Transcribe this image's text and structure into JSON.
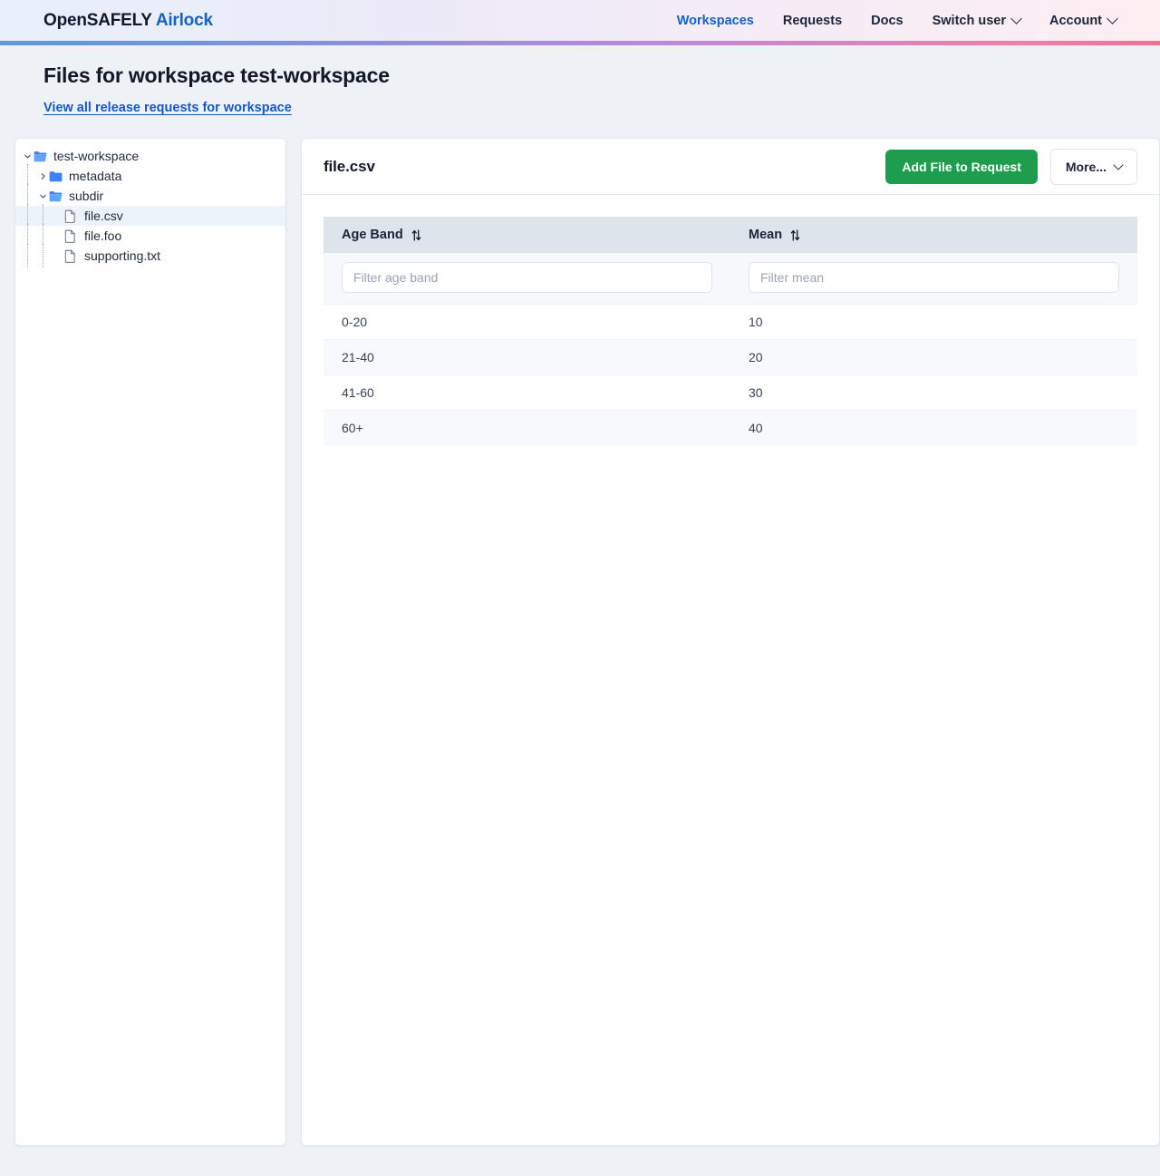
{
  "navbar": {
    "brand_primary": "OpenSAFELY",
    "brand_accent": "Airlock",
    "links": [
      {
        "label": "Workspaces",
        "active": true,
        "caret": false
      },
      {
        "label": "Requests",
        "active": false,
        "caret": false
      },
      {
        "label": "Docs",
        "active": false,
        "caret": false
      },
      {
        "label": "Switch user",
        "active": false,
        "caret": true
      },
      {
        "label": "Account",
        "active": false,
        "caret": true
      }
    ]
  },
  "page": {
    "title": "Files for workspace test-workspace",
    "release_link": "View all release requests for workspace"
  },
  "tree": {
    "nodes": [
      {
        "label": "test-workspace",
        "type": "folder-open",
        "depth": 0,
        "chevron": "down",
        "selected": false
      },
      {
        "label": "metadata",
        "type": "folder-closed",
        "depth": 1,
        "chevron": "right",
        "selected": false
      },
      {
        "label": "subdir",
        "type": "folder-open",
        "depth": 1,
        "chevron": "down",
        "selected": false
      },
      {
        "label": "file.csv",
        "type": "file",
        "depth": 2,
        "chevron": "none",
        "selected": true
      },
      {
        "label": "file.foo",
        "type": "file",
        "depth": 2,
        "chevron": "none",
        "selected": false
      },
      {
        "label": "supporting.txt",
        "type": "file",
        "depth": 2,
        "chevron": "none",
        "selected": false
      }
    ]
  },
  "content": {
    "file_title": "file.csv",
    "add_button": "Add File to Request",
    "more_button": "More..."
  },
  "table": {
    "columns": [
      {
        "header": "Age Band",
        "filter_placeholder": "Filter age band",
        "filter_value": ""
      },
      {
        "header": "Mean",
        "filter_placeholder": "Filter mean",
        "filter_value": ""
      }
    ],
    "rows": [
      [
        "0-20",
        "10"
      ],
      [
        "21-40",
        "20"
      ],
      [
        "41-60",
        "30"
      ],
      [
        "60+",
        "40"
      ]
    ]
  },
  "colors": {
    "brand_accent": "#1661c4",
    "link": "#1558c8",
    "primary_button": "#1f9d4e",
    "table_header": "#dde4ec",
    "selected_row": "#edf3fb",
    "page_background": "#eef2f7"
  }
}
